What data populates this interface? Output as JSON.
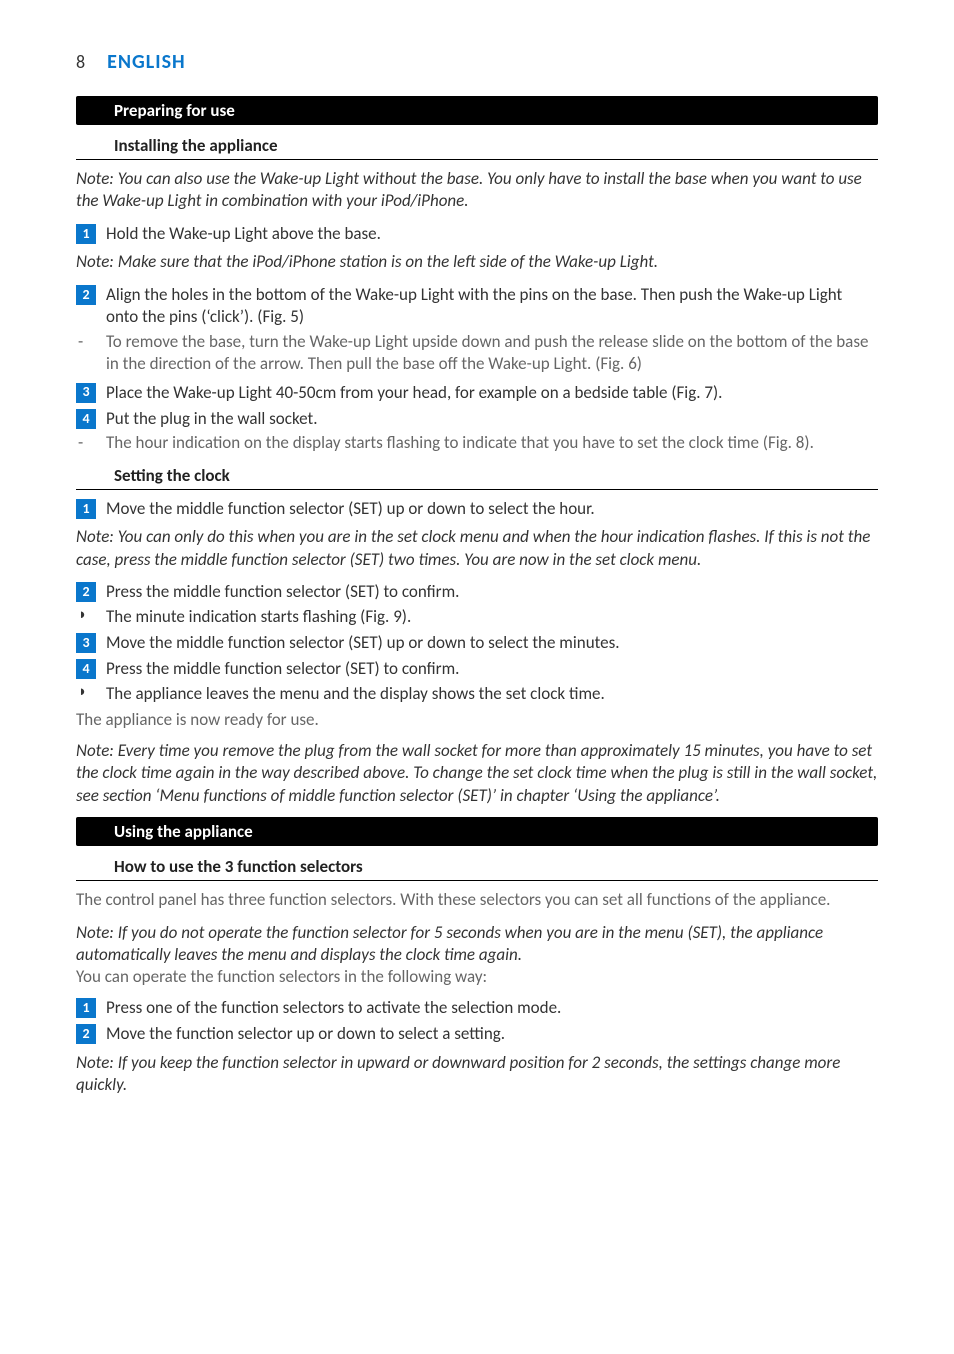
{
  "header": {
    "page_number": "8",
    "language": "ENGLISH"
  },
  "sections": {
    "preparing": {
      "bar": "Preparing for use",
      "installing": {
        "heading": "Installing the appliance",
        "note1": "Note: You can also use the Wake-up Light without the base. You only have to install the base when you want to use the Wake-up Light in combination with your iPod/iPhone.",
        "step1": "Hold the Wake-up Light above the base.",
        "note2": "Note: Make sure that the iPod/iPhone station is on the left side of the Wake-up Light.",
        "step2": "Align the holes in the bottom of the Wake-up Light with the pins on the base. Then push the Wake-up Light onto the pins (‘click’).  (Fig. 5)",
        "step2_dash": "To remove the base, turn the Wake-up Light upside down and push the release slide on the bottom of the base in the direction of the arrow. Then pull the base off the Wake-up Light.  (Fig. 6)",
        "step3": "Place the Wake-up Light 40-50cm from your head, for example on a bedside table (Fig. 7).",
        "step4": "Put the plug in the wall socket.",
        "step4_dash": "The hour indication on the display starts flashing to indicate that you have to set the clock time (Fig. 8)."
      },
      "setting_clock": {
        "heading": "Setting the clock",
        "step1": "Move the middle function selector (SET) up or down to select the hour.",
        "note1": "Note: You can only do this when you are in the set clock menu and when the hour indication flashes. If this is not the case, press the middle function selector (SET) two times. You are now in the set clock menu.",
        "step2": "Press the middle function selector (SET) to confirm.",
        "step2_arrow": "The minute indication starts flashing (Fig. 9).",
        "step3": "Move the middle function selector (SET) up or down to select the minutes.",
        "step4": "Press the middle function selector (SET) to confirm.",
        "step4_arrow": "The appliance leaves the menu and the display shows the set clock time.",
        "ready": "The appliance is now ready for use.",
        "note2": "Note: Every time you remove the plug from the wall socket for more than approximately 15 minutes, you have to set the clock time again in the way described above. To change the set clock time when the plug is still in the wall socket, see section ‘Menu functions of middle function selector (SET)’ in chapter ‘Using the appliance’."
      }
    },
    "using": {
      "bar": "Using the appliance",
      "how_to": {
        "heading": "How to use the 3 function selectors",
        "intro": "The control panel has three function selectors. With these selectors you can set all functions of the appliance.",
        "note1": "Note: If you do not operate the function selector for 5 seconds when you are in the menu (SET), the appliance automatically leaves the menu and displays the clock time again.",
        "operate": "You can operate the function selectors in the following way:",
        "step1": "Press one of the function selectors to activate the selection mode.",
        "step2": "Move the function selector up or down to select a setting.",
        "note2": "Note: If you keep the function selector in upward or downward position for 2 seconds, the settings change more quickly."
      }
    }
  }
}
